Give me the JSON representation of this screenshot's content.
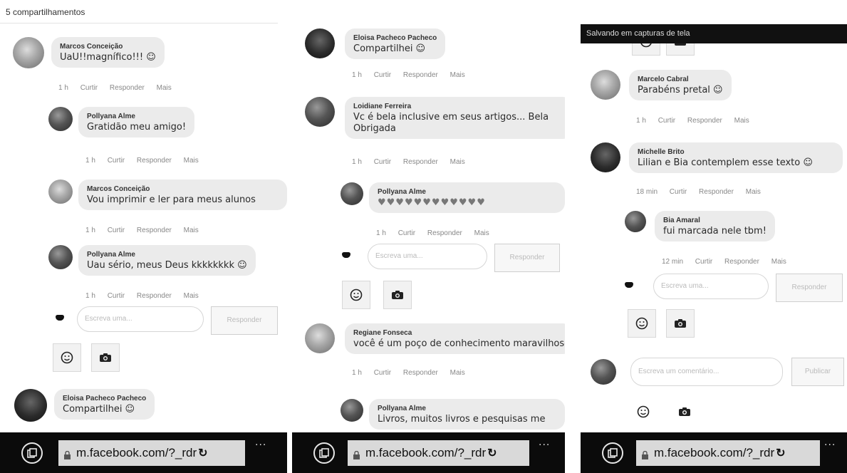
{
  "panels": [
    {
      "header": "5 compartilhamentos",
      "comments": [
        {
          "name": "Marcos Conceição",
          "text": "UaU!!magnífico!!! ☺",
          "meta": {
            "time": "1 h",
            "like": "Curtir",
            "reply": "Responder",
            "more": "Mais"
          }
        },
        {
          "name": "Pollyana Alme",
          "text": "Gratidão meu amigo!",
          "meta": {
            "time": "1 h",
            "like": "Curtir",
            "reply": "Responder",
            "more": "Mais"
          }
        },
        {
          "name": "Marcos Conceição",
          "text": "Vou imprimir e ler para meus alunos",
          "meta": {
            "time": "1 h",
            "like": "Curtir",
            "reply": "Responder",
            "more": "Mais"
          }
        },
        {
          "name": "Pollyana Alme",
          "text": "Uau sério, meus Deus kkkkkkkk ☺",
          "meta": {
            "time": "1 h",
            "like": "Curtir",
            "reply": "Responder",
            "more": "Mais"
          }
        },
        {
          "name": "Eloisa Pacheco Pacheco",
          "text": "Compartilhei ☺"
        }
      ],
      "reply_placeholder": "Escreva uma...",
      "reply_button": "Responder",
      "url": "m.facebook.com/?_rdr"
    },
    {
      "comments": [
        {
          "name": "Eloisa Pacheco Pacheco",
          "text": "Compartilhei ☺",
          "meta": {
            "time": "1 h",
            "like": "Curtir",
            "reply": "Responder",
            "more": "Mais"
          }
        },
        {
          "name": "Loidiane Ferreira",
          "text": "Vc é bela inclusive em seus artigos... Bela",
          "text2": "Obrigada",
          "meta": {
            "time": "1 h",
            "like": "Curtir",
            "reply": "Responder",
            "more": "Mais"
          }
        },
        {
          "name": "Pollyana Alme",
          "text": "♥♥♥♥♥♥♥♥♥♥♥♥",
          "meta": {
            "time": "1 h",
            "like": "Curtir",
            "reply": "Responder",
            "more": "Mais"
          }
        },
        {
          "name": "Regiane Fonseca",
          "text": "você é um poço de conhecimento maravilhoso",
          "meta": {
            "time": "1 h",
            "like": "Curtir",
            "reply": "Responder",
            "more": "Mais"
          }
        },
        {
          "name": "Pollyana Alme",
          "text": "Livros, muitos livros e pesquisas me"
        }
      ],
      "reply_placeholder": "Escreva uma...",
      "reply_button": "Responder",
      "url": "m.facebook.com/?_rdr"
    },
    {
      "status": "Salvando em capturas de tela",
      "comments": [
        {
          "name": "Marcelo Cabral",
          "text": "Parabéns pretal ☺",
          "meta": {
            "time": "1 h",
            "like": "Curtir",
            "reply": "Responder",
            "more": "Mais"
          }
        },
        {
          "name": "Michelle Brito",
          "text": "Lilian e Bia contemplem esse texto ☺",
          "meta": {
            "time": "18 min",
            "like": "Curtir",
            "reply": "Responder",
            "more": "Mais"
          }
        },
        {
          "name": "Bia Amaral",
          "text": "fui marcada nele tbm!",
          "meta": {
            "time": "12 min",
            "like": "Curtir",
            "reply": "Responder",
            "more": "Mais"
          }
        }
      ],
      "reply_placeholder": "Escreva uma...",
      "reply_button": "Responder",
      "comment_placeholder": "Escreva um comentário...",
      "comment_button": "Publicar",
      "url": "m.facebook.com/?_rdr"
    }
  ],
  "more_dots": "..."
}
